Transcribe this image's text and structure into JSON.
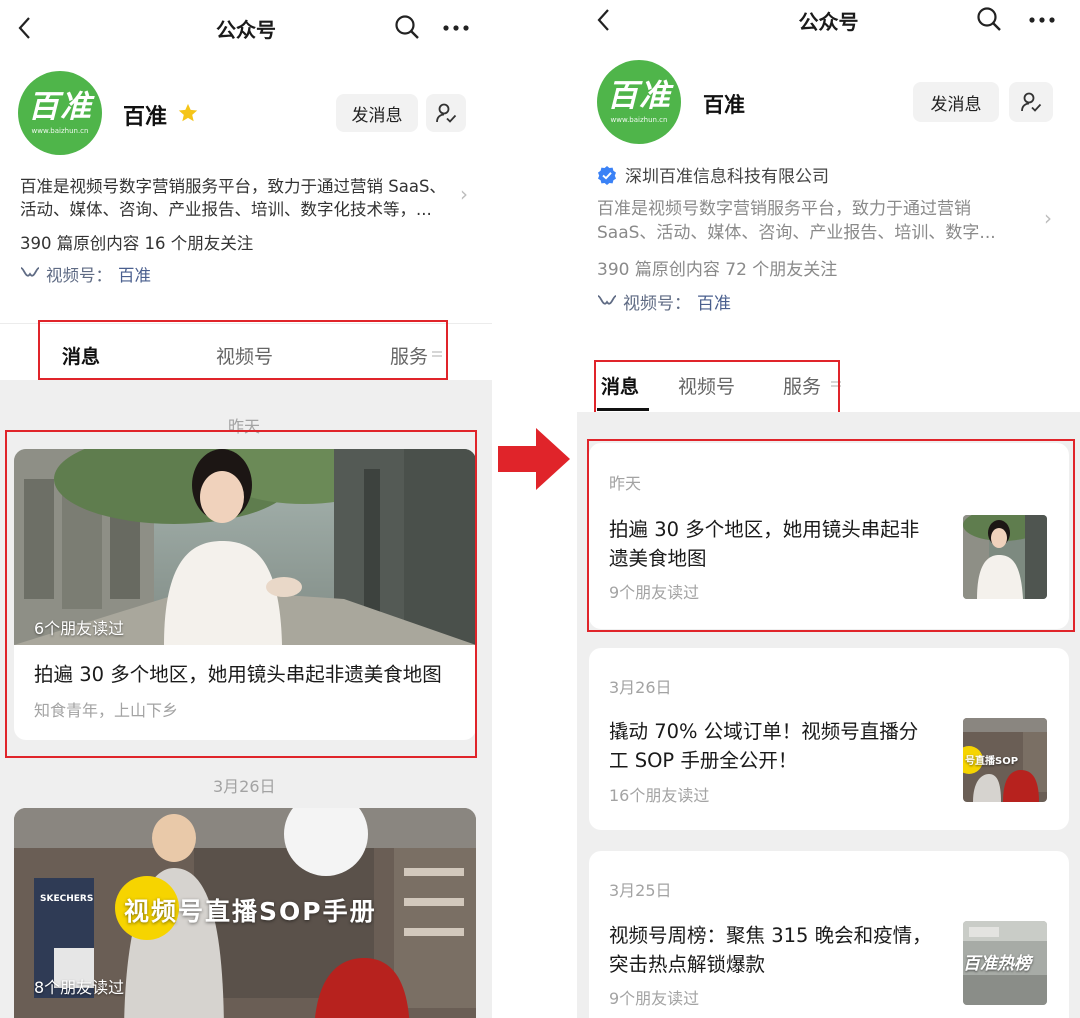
{
  "nav": {
    "title": "公众号"
  },
  "account": {
    "logo_text": "百准",
    "logo_subtext": "www.baizhun.cn",
    "name": "百准",
    "message_button": "发消息",
    "channel_label": "视频号：",
    "channel_name": "百准"
  },
  "left": {
    "description_lines": [
      "百准是视频号数字营销服务平台，致力于通过营销 SaaS、",
      "活动、媒体、咨询、产业报告、培训、数字化技术等，..."
    ],
    "stats": "390 篇原创内容  16 个朋友关注",
    "tabs": [
      "消息",
      "视频号",
      "服务"
    ],
    "posts": [
      {
        "date": "昨天",
        "reads": "6个朋友读过",
        "title": "拍遍 30 多个地区，她用镜头串起非遗美食地图",
        "author": "知食青年，上山下乡"
      },
      {
        "date": "3月26日",
        "reads": "8个朋友读过",
        "cover_text": "视频号直播SOP手册",
        "cover_brand": "SKECHERS"
      }
    ]
  },
  "right": {
    "company": "深圳百准信息科技有限公司",
    "description_lines": [
      "百准是视频号数字营销服务平台，致力于通过营销",
      "SaaS、活动、媒体、咨询、产业报告、培训、数字..."
    ],
    "stats": "390 篇原创内容  72 个朋友关注",
    "tabs": [
      "消息",
      "视频号",
      "服务"
    ],
    "posts": [
      {
        "date": "昨天",
        "title_lines": [
          "拍遍 30 多个地区，她用镜头串起非",
          "遗美食地图"
        ],
        "reads": "9个朋友读过"
      },
      {
        "date": "3月26日",
        "title_lines": [
          "撬动 70% 公域订单！视频号直播分",
          "工 SOP 手册全公开！"
        ],
        "reads": "16个朋友读过",
        "thumb_text": "号直播SOP"
      },
      {
        "date": "3月25日",
        "title_lines": [
          "视频号周榜：聚焦 315 晚会和疫情，",
          "突击热点解锁爆款"
        ],
        "reads": "9个朋友读过",
        "thumb_text": "百准热榜"
      }
    ]
  },
  "colors": {
    "brand_green": "#4fb54a",
    "highlight_red": "#e0242a",
    "star": "#f5c518",
    "verified_blue": "#3b82f6",
    "link_blue": "#4a5f8e",
    "feed_background": "#efefef"
  },
  "icons": [
    "back-icon",
    "search-icon",
    "more-icon",
    "star-icon",
    "user-check-icon",
    "channel-icon",
    "verified-icon",
    "chevron-right-icon",
    "menu-icon",
    "arrow-right-icon"
  ]
}
